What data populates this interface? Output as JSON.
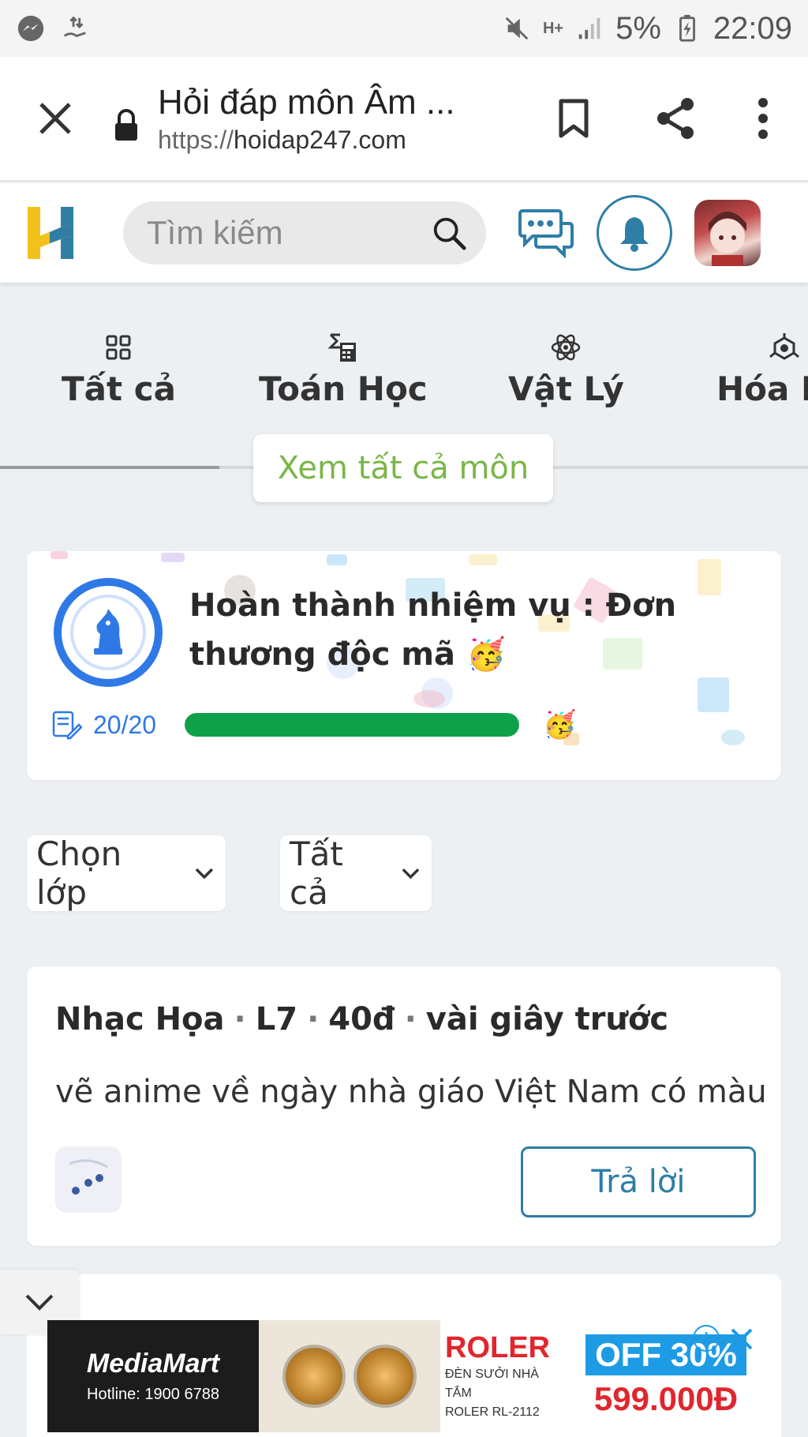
{
  "status_bar": {
    "battery": "5%",
    "time": "22:09",
    "network": "H+"
  },
  "browser": {
    "page_title": "Hỏi đáp môn Âm ...",
    "url_scheme": "https://",
    "url_host": "hoidap247.com"
  },
  "header": {
    "search_placeholder": "Tìm kiếm"
  },
  "subjects": {
    "items": [
      {
        "label": "Tất cả",
        "icon": "grid-icon"
      },
      {
        "label": "Toán Học",
        "icon": "calculator-icon"
      },
      {
        "label": "Vật Lý",
        "icon": "atom-icon"
      },
      {
        "label": "Hóa H",
        "icon": "molecule-icon"
      }
    ],
    "view_all": "Xem tất cả môn"
  },
  "mission": {
    "title": "Hoàn thành nhiệm vụ : Đơn thương độc mã 🥳",
    "progress_text": "20/20",
    "progress_fraction": 1.0,
    "emoji": "🥳",
    "colors": {
      "badge": "#2f79e6",
      "progress": "#0fa14a"
    }
  },
  "filters": {
    "grade": "Chọn lớp",
    "type": "Tất cả"
  },
  "question": {
    "subject": "Nhạc Họa",
    "grade": "L7",
    "points": "40đ",
    "time": "vài giây trước",
    "text": "vẽ anime về ngày nhà giáo Việt Nam có màu",
    "answer_label": "Trả lời"
  },
  "ad": {
    "brand": "MediaMart",
    "hotline": "Hotline: 1900 6788",
    "product": "ROLER",
    "product_desc1": "ĐÈN SƯỞI NHÀ TẮM",
    "product_desc2": "ROLER RL-2112",
    "discount": "OFF 30%",
    "price": "599.000Đ"
  },
  "colors": {
    "accent": "#2e7ea6",
    "green_link": "#7ab648",
    "logo_yellow": "#f2c21b",
    "logo_blue": "#2e7ea6"
  }
}
